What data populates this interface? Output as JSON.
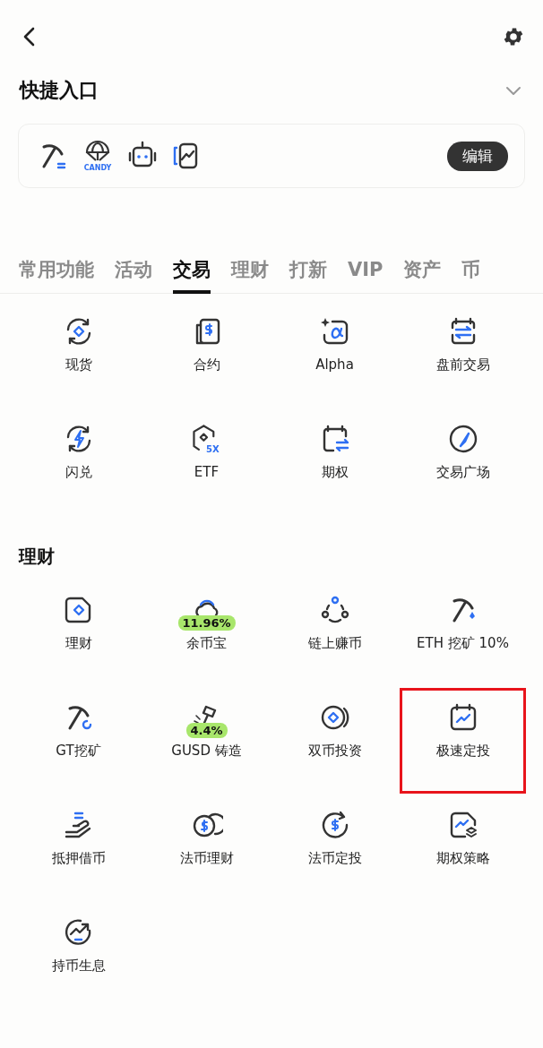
{
  "quick_access": {
    "title": "快捷入口",
    "expanded": false,
    "candy_label": "CANDY",
    "edit_button": "编辑"
  },
  "tabs": [
    {
      "label": "常用功能",
      "selected": false
    },
    {
      "label": "活动",
      "selected": false
    },
    {
      "label": "交易",
      "selected": true
    },
    {
      "label": "理财",
      "selected": false
    },
    {
      "label": "打新",
      "selected": false
    },
    {
      "label": "VIP",
      "selected": false
    },
    {
      "label": "资产",
      "selected": false
    },
    {
      "label": "币",
      "selected": false
    }
  ],
  "sections": [
    {
      "items": [
        {
          "label": "现货",
          "highlighted": false
        },
        {
          "label": "合约",
          "highlighted": false
        },
        {
          "label": "Alpha",
          "highlighted": false
        },
        {
          "label": "盘前交易",
          "highlighted": false
        },
        {
          "label": "闪兑",
          "highlighted": false
        },
        {
          "label": "ETF",
          "icon_text": "5X",
          "highlighted": false
        },
        {
          "label": "期权",
          "highlighted": false
        },
        {
          "label": "交易广场",
          "highlighted": false
        }
      ]
    },
    {
      "title": "理财",
      "items": [
        {
          "label": "理财",
          "highlighted": false
        },
        {
          "label": "余币宝",
          "badge": "11.96%",
          "highlighted": false
        },
        {
          "label": "链上赚币",
          "highlighted": false
        },
        {
          "label": "ETH 挖矿 10%",
          "highlighted": false
        },
        {
          "label": "GT挖矿",
          "highlighted": false
        },
        {
          "label": "GUSD 铸造",
          "badge": "4.4%",
          "highlighted": false
        },
        {
          "label": "双币投资",
          "highlighted": false
        },
        {
          "label": "极速定投",
          "highlighted": true
        },
        {
          "label": "抵押借币",
          "highlighted": false
        },
        {
          "label": "法币理财",
          "highlighted": false
        },
        {
          "label": "法币定投",
          "highlighted": false
        },
        {
          "label": "期权策略",
          "highlighted": false
        },
        {
          "label": "持币生息",
          "highlighted": false
        }
      ]
    }
  ]
}
